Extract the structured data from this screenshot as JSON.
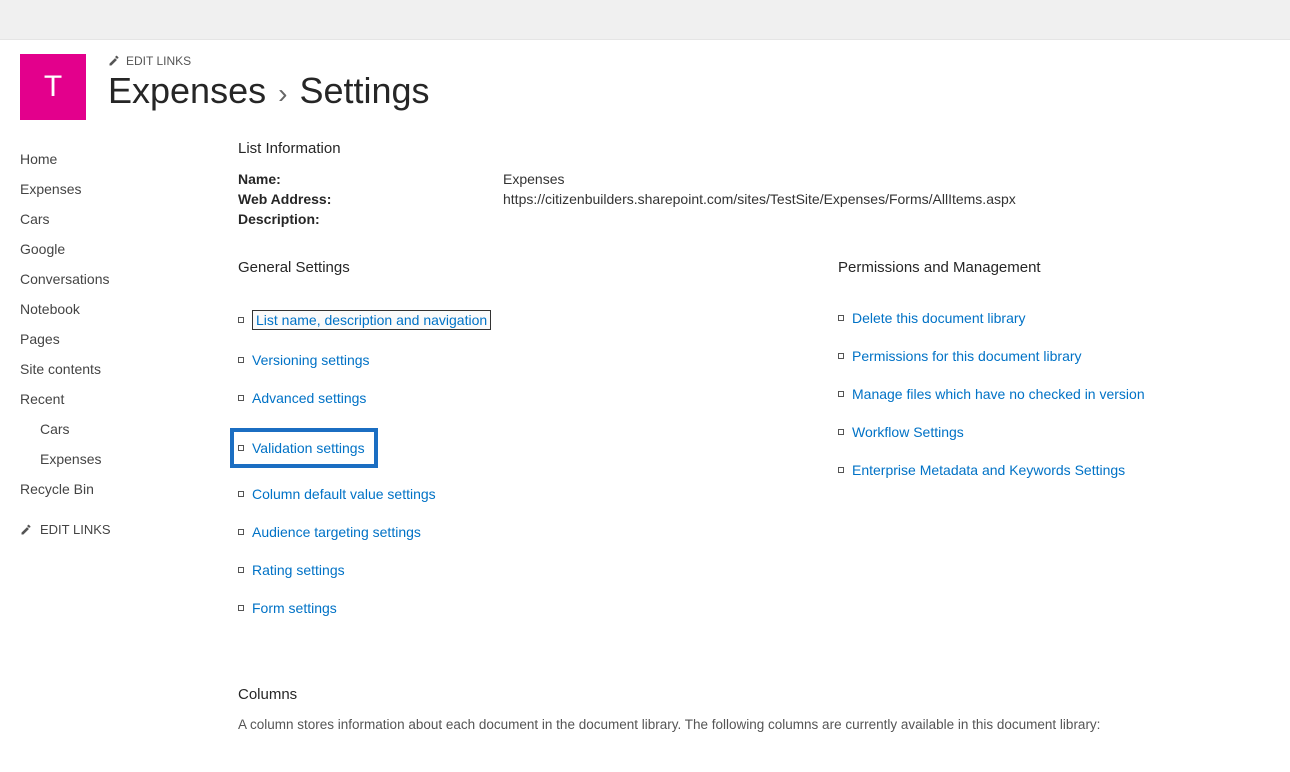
{
  "site": {
    "logo_letter": "T",
    "edit_links_label": "EDIT LINKS"
  },
  "breadcrumb": {
    "parent": "Expenses",
    "current": "Settings"
  },
  "sidebar": {
    "items": [
      {
        "label": "Home",
        "indent": false
      },
      {
        "label": "Expenses",
        "indent": false
      },
      {
        "label": "Cars",
        "indent": false
      },
      {
        "label": "Google",
        "indent": false
      },
      {
        "label": "Conversations",
        "indent": false
      },
      {
        "label": "Notebook",
        "indent": false
      },
      {
        "label": "Pages",
        "indent": false
      },
      {
        "label": "Site contents",
        "indent": false
      },
      {
        "label": "Recent",
        "indent": false
      },
      {
        "label": "Cars",
        "indent": true
      },
      {
        "label": "Expenses",
        "indent": true
      },
      {
        "label": "Recycle Bin",
        "indent": false
      }
    ],
    "edit_links_label": "EDIT LINKS"
  },
  "list_info": {
    "heading": "List Information",
    "name_label": "Name:",
    "name_value": "Expenses",
    "web_label": "Web Address:",
    "web_value": "https://citizenbuilders.sharepoint.com/sites/TestSite/Expenses/Forms/AllItems.aspx",
    "desc_label": "Description:"
  },
  "general": {
    "heading": "General Settings",
    "items": [
      "List name, description and navigation",
      "Versioning settings",
      "Advanced settings",
      "Validation settings",
      "Column default value settings",
      "Audience targeting settings",
      "Rating settings",
      "Form settings"
    ]
  },
  "permissions": {
    "heading": "Permissions and Management",
    "items": [
      "Delete this document library",
      "Permissions for this document library",
      "Manage files which have no checked in version",
      "Workflow Settings",
      "Enterprise Metadata and Keywords Settings"
    ]
  },
  "columns": {
    "heading": "Columns",
    "description": "A column stores information about each document in the document library. The following columns are currently available in this document library:"
  }
}
